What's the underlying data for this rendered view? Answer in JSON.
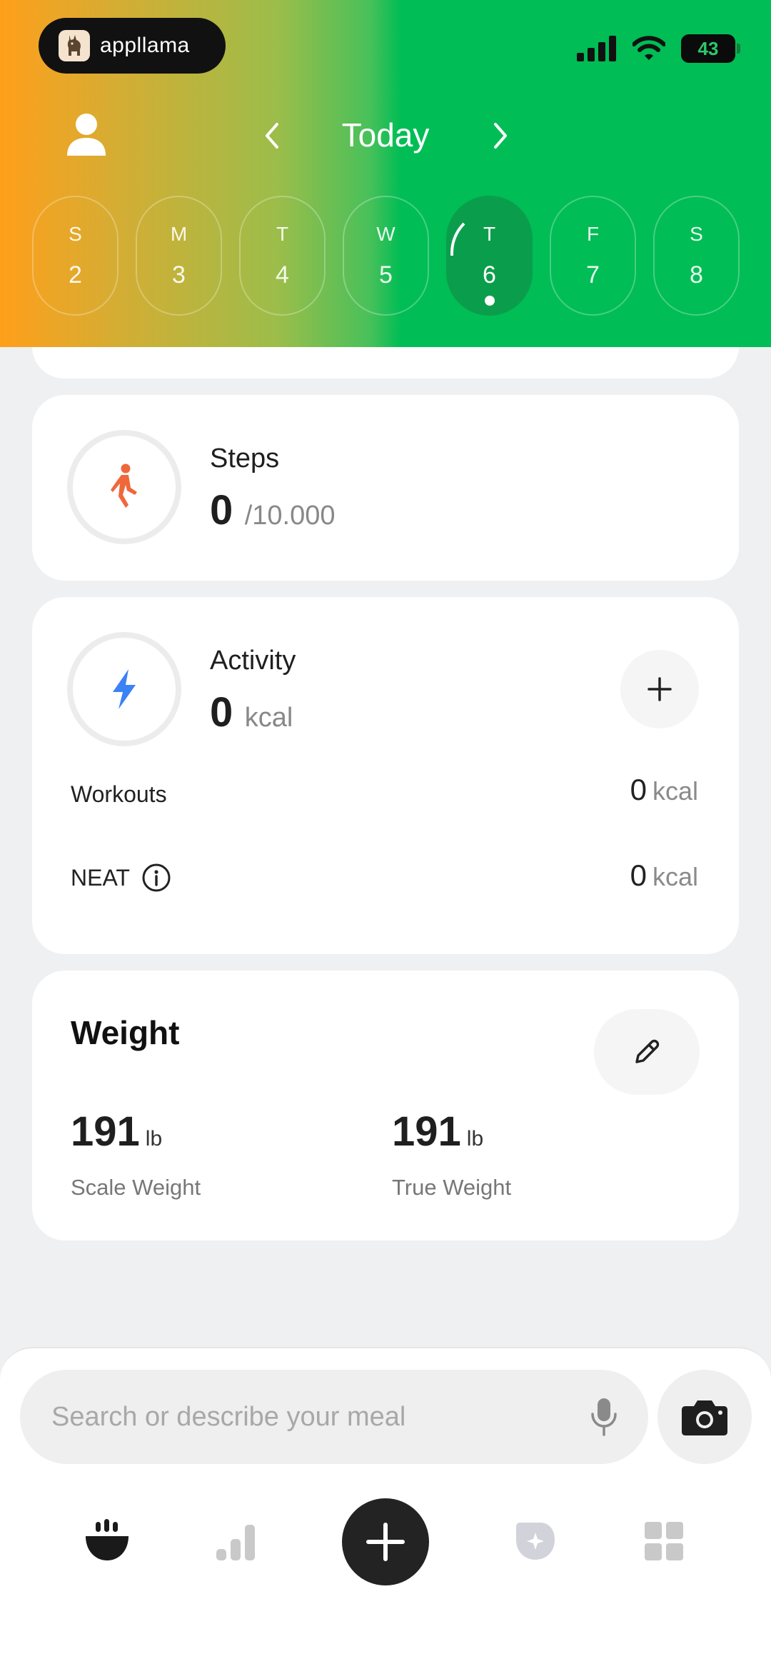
{
  "status_bar": {
    "app_name": "appllama",
    "battery": "43"
  },
  "header": {
    "date_title": "Today"
  },
  "week": [
    {
      "letter": "S",
      "num": "2"
    },
    {
      "letter": "M",
      "num": "3"
    },
    {
      "letter": "T",
      "num": "4"
    },
    {
      "letter": "W",
      "num": "5"
    },
    {
      "letter": "T",
      "num": "6",
      "selected": true
    },
    {
      "letter": "F",
      "num": "7"
    },
    {
      "letter": "S",
      "num": "8"
    }
  ],
  "steps": {
    "title": "Steps",
    "value": "0",
    "goal": "/10.000",
    "accent": "#f0673a"
  },
  "activity": {
    "title": "Activity",
    "value": "0",
    "unit": "kcal",
    "accent": "#3b82f6",
    "rows": [
      {
        "label": "Workouts",
        "value": "0",
        "unit": "kcal"
      },
      {
        "label": "NEAT",
        "value": "0",
        "unit": "kcal"
      }
    ]
  },
  "weight": {
    "title": "Weight",
    "scale": {
      "value": "191",
      "unit": "lb",
      "label": "Scale Weight"
    },
    "true": {
      "value": "191",
      "unit": "lb",
      "label": "True Weight"
    }
  },
  "search": {
    "placeholder": "Search or describe your meal"
  },
  "tabs": [
    "meals-icon",
    "stats-icon",
    "add-icon",
    "insights-icon",
    "more-icon"
  ]
}
